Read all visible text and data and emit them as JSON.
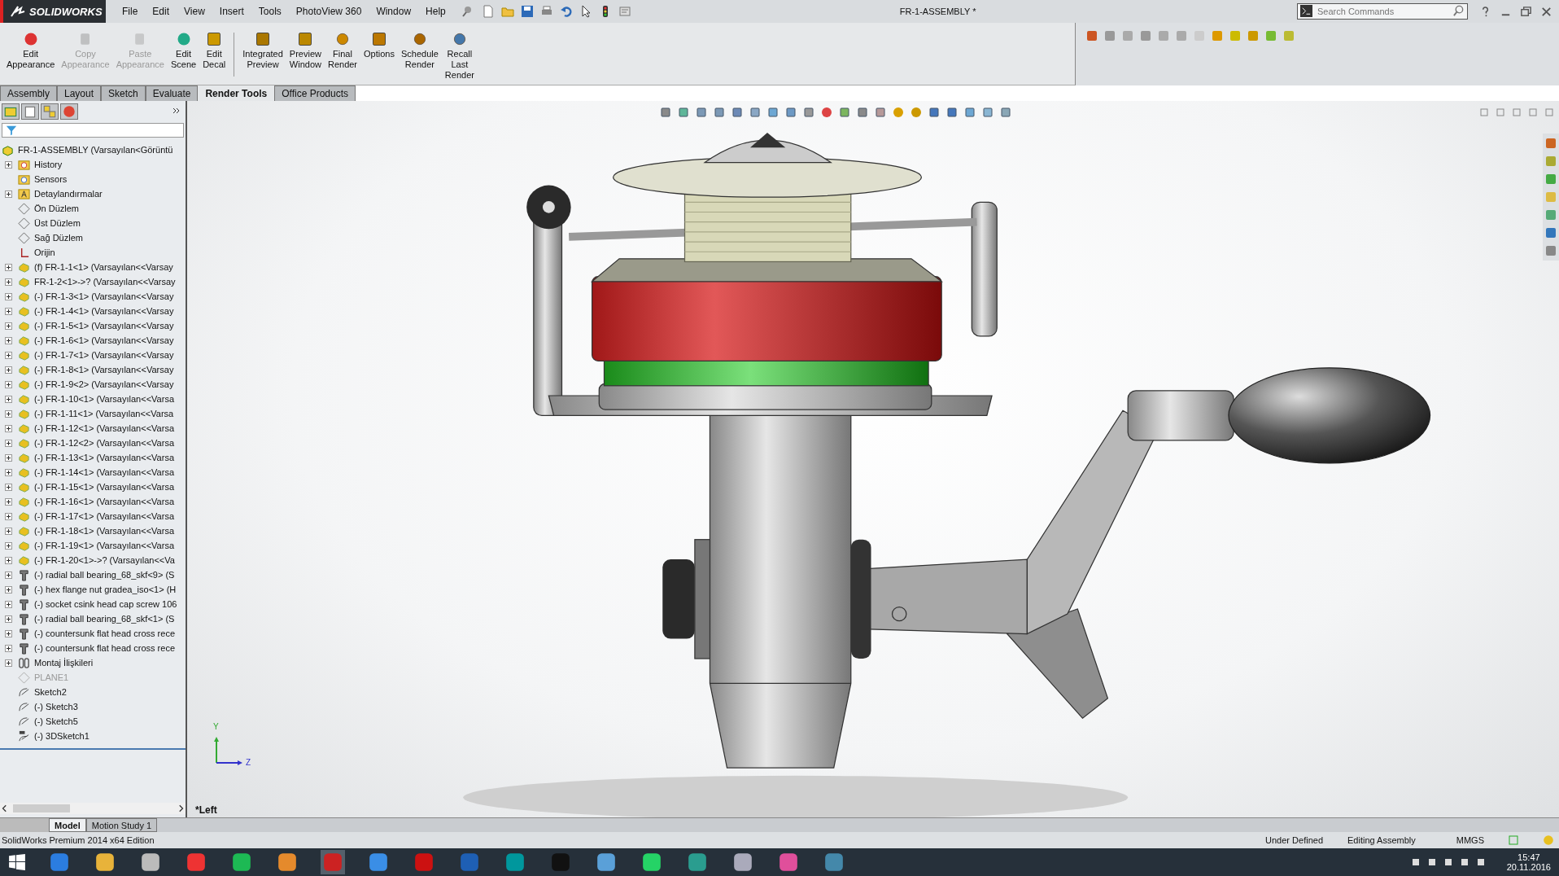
{
  "app": {
    "logo": "SOLIDWORKS"
  },
  "menu": [
    "File",
    "Edit",
    "View",
    "Insert",
    "Tools",
    "PhotoView 360",
    "Window",
    "Help"
  ],
  "window_title": "FR-1-ASSEMBLY *",
  "search": {
    "placeholder": "Search Commands"
  },
  "ribbon": {
    "groups": [
      [
        {
          "label": "Edit Appearance",
          "kind": "appearance",
          "disabled": false
        },
        {
          "label": "Copy Appearance",
          "kind": "copy",
          "disabled": true
        },
        {
          "label": "Paste Appearance",
          "kind": "paste",
          "disabled": true
        },
        {
          "label": "Edit Scene",
          "kind": "scene",
          "disabled": false
        },
        {
          "label": "Edit Decal",
          "kind": "decal",
          "disabled": false
        }
      ],
      [
        {
          "label": "Integrated Preview",
          "kind": "preview",
          "disabled": false
        },
        {
          "label": "Preview Window",
          "kind": "window",
          "disabled": false
        },
        {
          "label": "Final Render",
          "kind": "render",
          "disabled": false
        },
        {
          "label": "Options",
          "kind": "options",
          "disabled": false
        },
        {
          "label": "Schedule Render",
          "kind": "schedule",
          "disabled": false
        },
        {
          "label": "Recall Last Render",
          "kind": "recall",
          "disabled": false
        }
      ]
    ]
  },
  "tabs": [
    {
      "label": "Assembly",
      "selected": false
    },
    {
      "label": "Layout",
      "selected": false
    },
    {
      "label": "Sketch",
      "selected": false
    },
    {
      "label": "Evaluate",
      "selected": false
    },
    {
      "label": "Render Tools",
      "selected": true
    },
    {
      "label": "Office Products",
      "selected": false
    }
  ],
  "tree": {
    "root": "FR-1-ASSEMBLY  (Varsayılan<Görüntü",
    "items": [
      {
        "text": "History",
        "kind": "history",
        "expandable": true,
        "disabled": false
      },
      {
        "text": "Sensors",
        "kind": "sensors",
        "expandable": false,
        "disabled": false
      },
      {
        "text": "Detaylandırmalar",
        "kind": "annotations",
        "expandable": true,
        "disabled": false
      },
      {
        "text": "Ön Düzlem",
        "kind": "plane",
        "expandable": false,
        "disabled": false
      },
      {
        "text": "Üst Düzlem",
        "kind": "plane",
        "expandable": false,
        "disabled": false
      },
      {
        "text": "Sağ Düzlem",
        "kind": "plane",
        "expandable": false,
        "disabled": false
      },
      {
        "text": "Orijin",
        "kind": "origin",
        "expandable": false,
        "disabled": false
      },
      {
        "text": "(f) FR-1-1<1> (Varsayılan<<Varsay",
        "kind": "part",
        "expandable": true,
        "disabled": false
      },
      {
        "text": "FR-1-2<1>->? (Varsayılan<<Varsay",
        "kind": "part",
        "expandable": true,
        "disabled": false
      },
      {
        "text": "(-) FR-1-3<1> (Varsayılan<<Varsay",
        "kind": "part",
        "expandable": true,
        "disabled": false
      },
      {
        "text": "(-) FR-1-4<1> (Varsayılan<<Varsay",
        "kind": "part",
        "expandable": true,
        "disabled": false
      },
      {
        "text": "(-) FR-1-5<1> (Varsayılan<<Varsay",
        "kind": "part",
        "expandable": true,
        "disabled": false
      },
      {
        "text": "(-) FR-1-6<1> (Varsayılan<<Varsay",
        "kind": "part",
        "expandable": true,
        "disabled": false
      },
      {
        "text": "(-) FR-1-7<1> (Varsayılan<<Varsay",
        "kind": "part",
        "expandable": true,
        "disabled": false
      },
      {
        "text": "(-) FR-1-8<1> (Varsayılan<<Varsay",
        "kind": "part",
        "expandable": true,
        "disabled": false
      },
      {
        "text": "(-) FR-1-9<2> (Varsayılan<<Varsay",
        "kind": "part",
        "expandable": true,
        "disabled": false
      },
      {
        "text": "(-) FR-1-10<1> (Varsayılan<<Varsa",
        "kind": "part",
        "expandable": true,
        "disabled": false
      },
      {
        "text": "(-) FR-1-11<1> (Varsayılan<<Varsa",
        "kind": "part",
        "expandable": true,
        "disabled": false
      },
      {
        "text": "(-) FR-1-12<1> (Varsayılan<<Varsa",
        "kind": "part",
        "expandable": true,
        "disabled": false
      },
      {
        "text": "(-) FR-1-12<2> (Varsayılan<<Varsa",
        "kind": "part",
        "expandable": true,
        "disabled": false
      },
      {
        "text": "(-) FR-1-13<1> (Varsayılan<<Varsa",
        "kind": "part",
        "expandable": true,
        "disabled": false
      },
      {
        "text": "(-) FR-1-14<1> (Varsayılan<<Varsa",
        "kind": "part",
        "expandable": true,
        "disabled": false
      },
      {
        "text": "(-) FR-1-15<1> (Varsayılan<<Varsa",
        "kind": "part",
        "expandable": true,
        "disabled": false
      },
      {
        "text": "(-) FR-1-16<1> (Varsayılan<<Varsa",
        "kind": "part",
        "expandable": true,
        "disabled": false
      },
      {
        "text": "(-) FR-1-17<1> (Varsayılan<<Varsa",
        "kind": "part",
        "expandable": true,
        "disabled": false
      },
      {
        "text": "(-) FR-1-18<1> (Varsayılan<<Varsa",
        "kind": "part",
        "expandable": true,
        "disabled": false
      },
      {
        "text": "(-) FR-1-19<1> (Varsayılan<<Varsa",
        "kind": "part",
        "expandable": true,
        "disabled": false
      },
      {
        "text": "(-) FR-1-20<1>->? (Varsayılan<<Va",
        "kind": "part",
        "expandable": true,
        "disabled": false
      },
      {
        "text": "(-) radial ball bearing_68_skf<9> (S",
        "kind": "fastener",
        "expandable": true,
        "disabled": false
      },
      {
        "text": "(-) hex flange nut gradea_iso<1> (H",
        "kind": "fastener",
        "expandable": true,
        "disabled": false
      },
      {
        "text": "(-) socket csink head cap screw 106",
        "kind": "fastener",
        "expandable": true,
        "disabled": false
      },
      {
        "text": "(-) radial ball bearing_68_skf<1> (S",
        "kind": "fastener",
        "expandable": true,
        "disabled": false
      },
      {
        "text": "(-) countersunk flat head cross rece",
        "kind": "fastener",
        "expandable": true,
        "disabled": false
      },
      {
        "text": "(-) countersunk flat head cross rece",
        "kind": "fastener",
        "expandable": true,
        "disabled": false
      },
      {
        "text": "Montaj İlişkileri",
        "kind": "mates",
        "expandable": true,
        "disabled": false
      },
      {
        "text": "PLANE1",
        "kind": "plane",
        "expandable": false,
        "disabled": true
      },
      {
        "text": "Sketch2",
        "kind": "sketch",
        "expandable": false,
        "disabled": false
      },
      {
        "text": "(-) Sketch3",
        "kind": "sketch",
        "expandable": false,
        "disabled": false
      },
      {
        "text": "(-) Sketch5",
        "kind": "sketch",
        "expandable": false,
        "disabled": false
      },
      {
        "text": "(-) 3DSketch1",
        "kind": "sketch3d",
        "expandable": false,
        "disabled": false
      }
    ]
  },
  "view_label": "*Left",
  "triad": {
    "y": "Y",
    "z": "Z"
  },
  "bottom_tabs": [
    {
      "label": "Model",
      "selected": true
    },
    {
      "label": "Motion Study 1",
      "selected": false
    }
  ],
  "status": {
    "product": "SolidWorks Premium 2014 x64 Edition",
    "state": "Under Defined",
    "mode": "Editing Assembly",
    "units": "MMGS"
  },
  "clock": {
    "time": "15:47",
    "date": "20.11.2016"
  }
}
